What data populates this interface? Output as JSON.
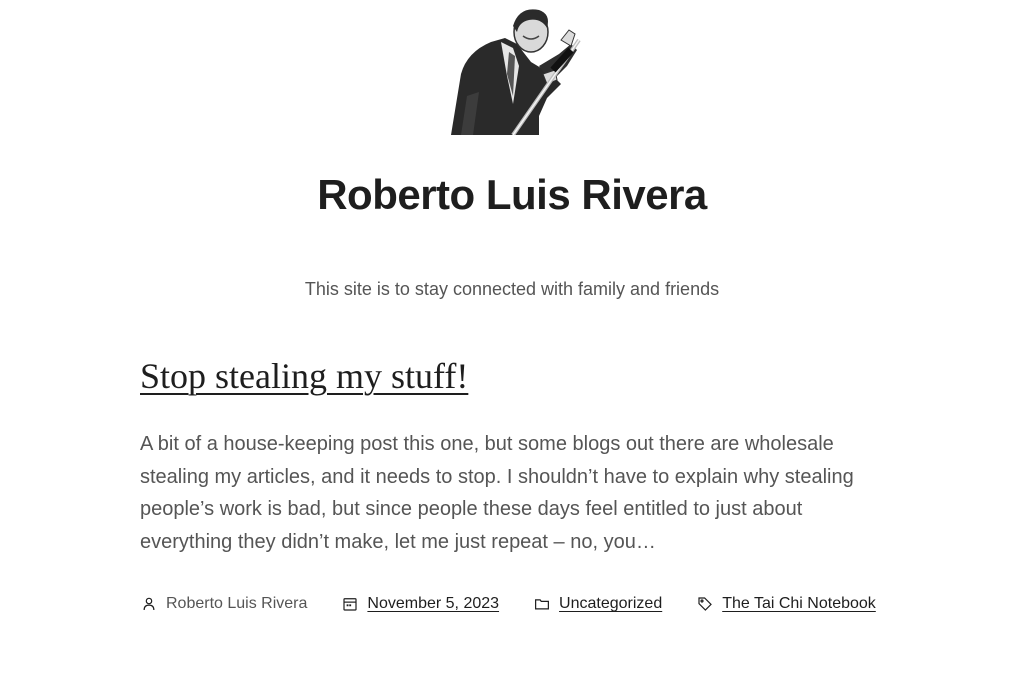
{
  "site": {
    "logo_icon": "person-with-sword-image",
    "title": "Roberto Luis Rivera",
    "tagline": "This site is to stay connected with family and friends"
  },
  "post": {
    "title": "Stop stealing my stuff!",
    "excerpt": "A bit of a house-keeping post this one, but some blogs out there are wholesale stealing my articles, and it needs to stop. I shouldn’t have to explain why stealing people’s work is bad, but since people these days feel entitled to just about everything they didn’t make, let me just repeat – no, you…",
    "meta": {
      "author": "Roberto Luis Rivera",
      "date": "November 5, 2023",
      "category": "Uncategorized",
      "tag": "The Tai Chi Notebook"
    }
  },
  "icons": {
    "author": "person-icon",
    "date": "calendar-icon",
    "category": "folder-icon",
    "tag": "tag-icon"
  },
  "colors": {
    "background": "#ffffff",
    "text": "#1e1e1e",
    "muted": "#555555"
  }
}
